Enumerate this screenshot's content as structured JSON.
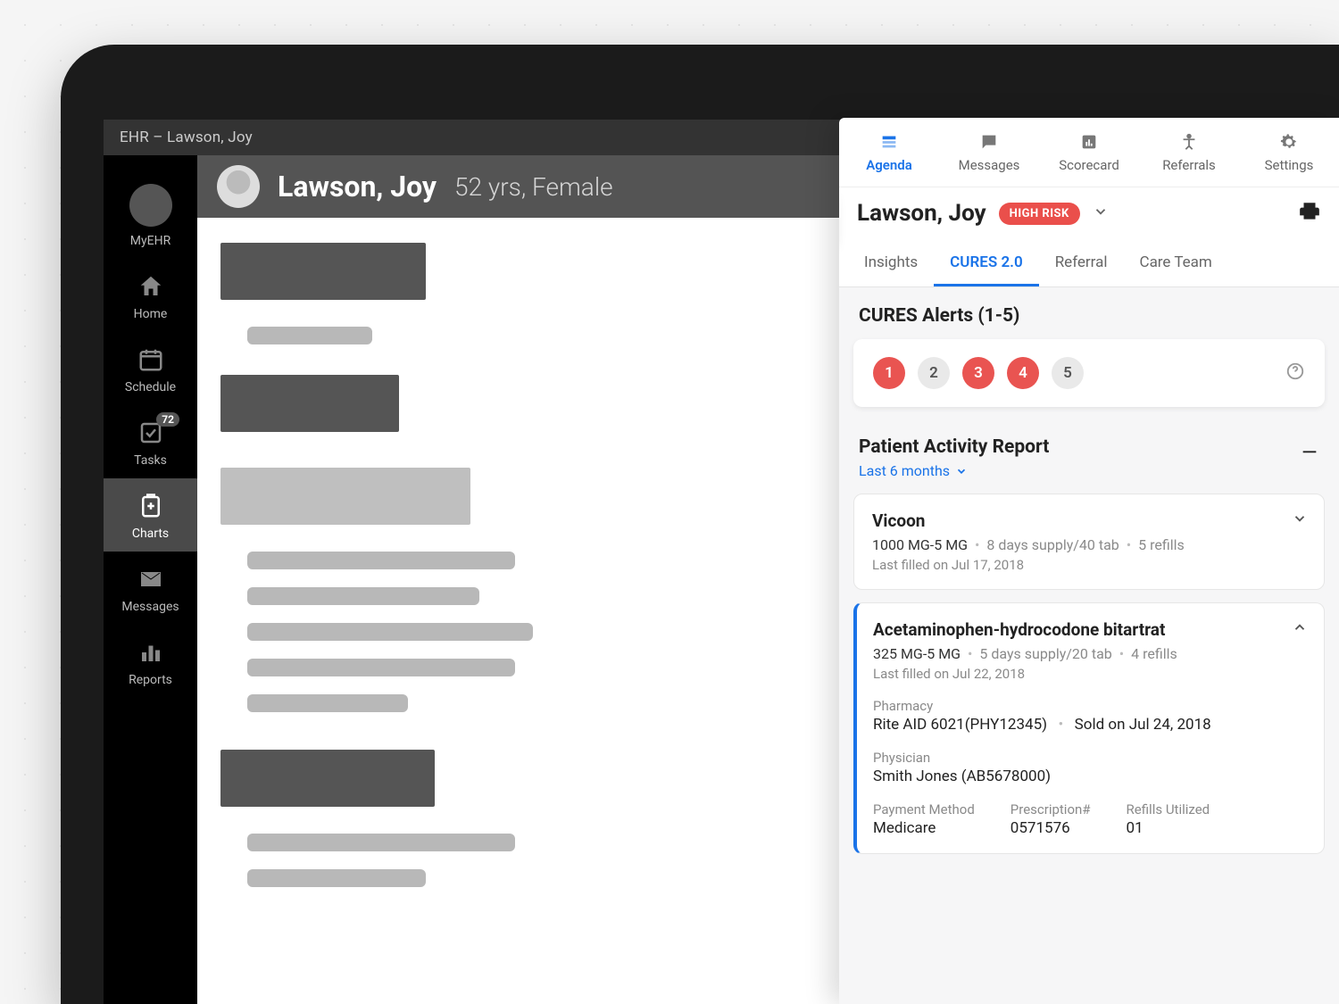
{
  "window_title": "EHR – Lawson, Joy",
  "sidebar": {
    "items": [
      {
        "id": "myehr",
        "label": "MyEHR",
        "active": false
      },
      {
        "id": "home",
        "label": "Home",
        "active": false
      },
      {
        "id": "schedule",
        "label": "Schedule",
        "active": false
      },
      {
        "id": "tasks",
        "label": "Tasks",
        "active": false,
        "badge": "72"
      },
      {
        "id": "charts",
        "label": "Charts",
        "active": true
      },
      {
        "id": "messages",
        "label": "Messages",
        "active": false
      },
      {
        "id": "reports",
        "label": "Reports",
        "active": false
      }
    ]
  },
  "patient_header": {
    "name": "Lawson, Joy",
    "meta": "52 yrs, Female"
  },
  "panel": {
    "tabs": [
      {
        "id": "agenda",
        "label": "Agenda",
        "active": true
      },
      {
        "id": "messages",
        "label": "Messages",
        "active": false
      },
      {
        "id": "scorecard",
        "label": "Scorecard",
        "active": false
      },
      {
        "id": "referrals",
        "label": "Referrals",
        "active": false
      },
      {
        "id": "settings",
        "label": "Settings",
        "active": false
      }
    ],
    "patient": {
      "name": "Lawson, Joy",
      "risk_badge": "HIGH RISK"
    },
    "sub_tabs": [
      {
        "id": "insights",
        "label": "Insights",
        "active": false
      },
      {
        "id": "cures",
        "label": "CURES 2.0",
        "active": true
      },
      {
        "id": "referral",
        "label": "Referral",
        "active": false
      },
      {
        "id": "careteam",
        "label": "Care Team",
        "active": false
      }
    ],
    "cures": {
      "title": "CURES Alerts (1-5)",
      "alerts": [
        {
          "n": "1",
          "severe": true
        },
        {
          "n": "2",
          "severe": false
        },
        {
          "n": "3",
          "severe": true
        },
        {
          "n": "4",
          "severe": true
        },
        {
          "n": "5",
          "severe": false
        }
      ]
    },
    "par": {
      "title": "Patient Activity Report",
      "range": "Last 6 months",
      "items": [
        {
          "name": "Vicoon",
          "dose": "1000 MG-5 MG",
          "supply": "8 days supply/40 tab",
          "refills": "5 refills",
          "last_filled": "Last filled on Jul 17, 2018",
          "expanded": false
        },
        {
          "name": "Acetaminophen-hydrocodone bitartrat",
          "dose": "325 MG-5 MG",
          "supply": "5 days supply/20 tab",
          "refills": "4 refills",
          "last_filled": "Last filled on Jul 22, 2018",
          "expanded": true,
          "pharmacy_label": "Pharmacy",
          "pharmacy": "Rite AID 6021(PHY12345)",
          "sold_sep": "•",
          "sold": "Sold on Jul 24, 2018",
          "physician_label": "Physician",
          "physician": "Smith Jones (AB5678000)",
          "pay_label": "Payment Method",
          "pay": "Medicare",
          "rx_label": "Prescription#",
          "rx": "0571576",
          "refu_label": "Refills Utilized",
          "refu": "01"
        }
      ]
    }
  }
}
